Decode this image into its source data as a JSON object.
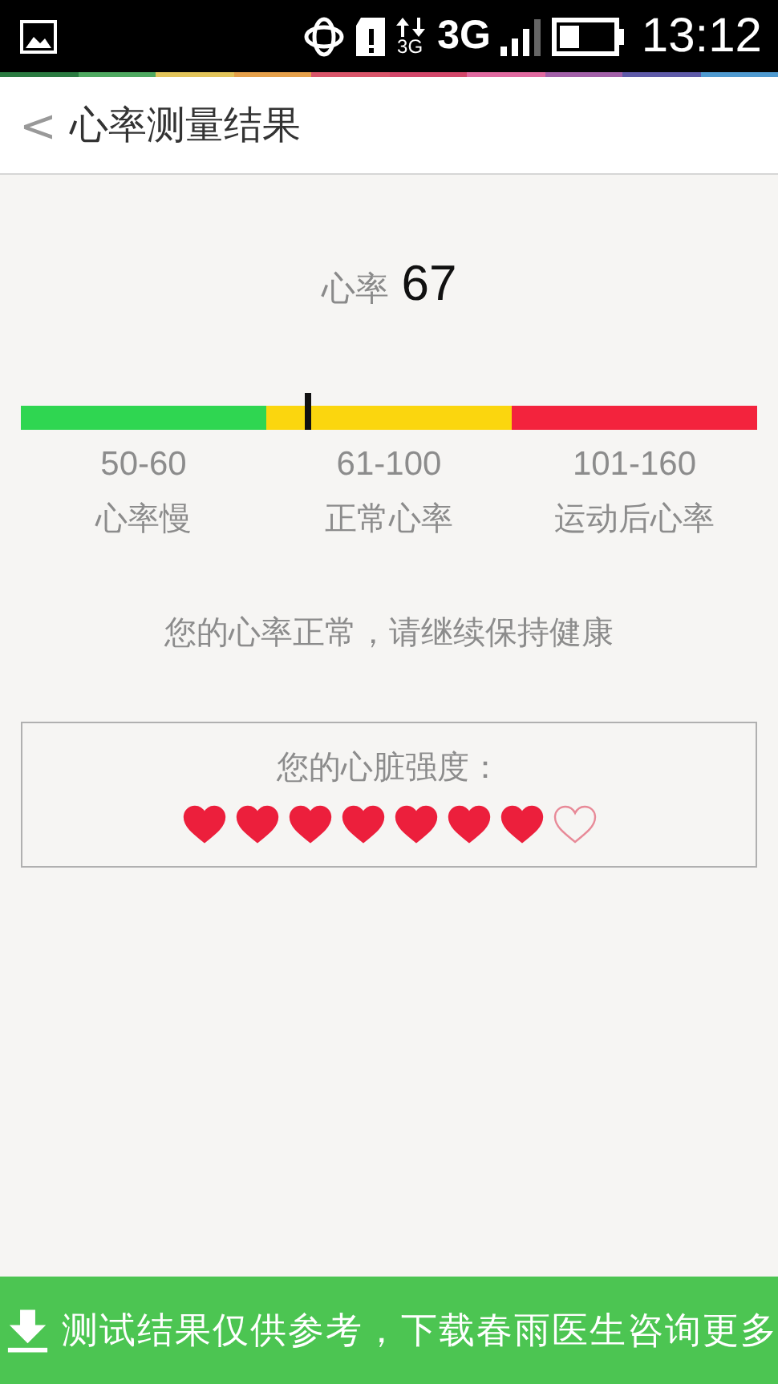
{
  "status_bar": {
    "network_small": "3G",
    "network": "3G",
    "time": "13:12"
  },
  "header": {
    "back": "<",
    "title": "心率测量结果"
  },
  "heart_rate": {
    "label": "心率",
    "value": "67"
  },
  "scale": {
    "segments": [
      {
        "range": "50-60",
        "label": "心率慢",
        "color": "#2fd651"
      },
      {
        "range": "61-100",
        "label": "正常心率",
        "color": "#fbd60e"
      },
      {
        "range": "101-160",
        "label": "运动后心率",
        "color": "#f3233d"
      }
    ]
  },
  "message": "您的心率正常，请继续保持健康",
  "strength": {
    "label": "您的心脏强度：",
    "stars": 7
  },
  "footer": {
    "text": "测试结果仅供参考，下载春雨医生咨询更多"
  }
}
